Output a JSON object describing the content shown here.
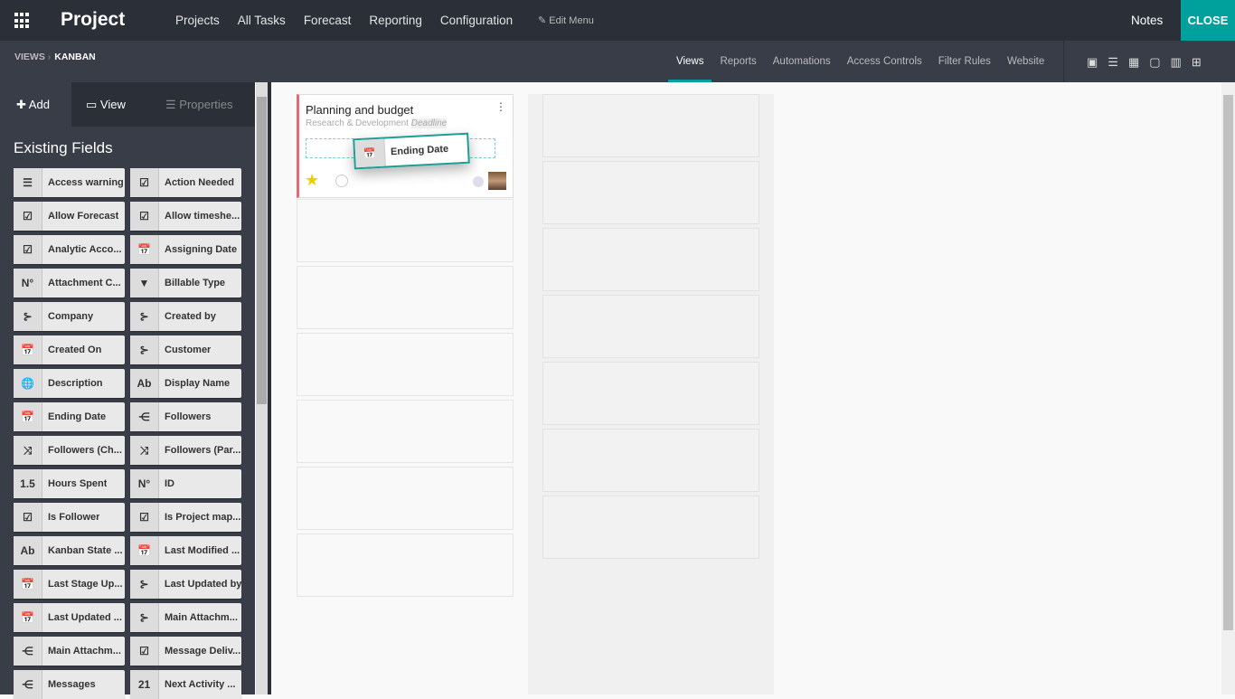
{
  "topbar": {
    "app": "Project",
    "menu": [
      "Projects",
      "All Tasks",
      "Forecast",
      "Reporting",
      "Configuration"
    ],
    "edit_menu": "Edit Menu",
    "notes": "Notes",
    "close": "CLOSE"
  },
  "breadcrumb": {
    "parent": "VIEWS",
    "current": "KANBAN"
  },
  "studio_tabs": [
    "Views",
    "Reports",
    "Automations",
    "Access Controls",
    "Filter Rules",
    "Website"
  ],
  "active_tab": "Views",
  "view_icons": [
    "form-view-icon",
    "list-view-icon",
    "kanban-view-icon",
    "calendar-view-icon",
    "graph-view-icon",
    "pivot-view-icon"
  ],
  "sidebar": {
    "tabs": {
      "add": "Add",
      "view": "View",
      "properties": "Properties"
    },
    "heading": "Existing Fields",
    "fields": [
      [
        "Access warning",
        "text"
      ],
      [
        "Action Needed",
        "bool"
      ],
      [
        "Allow Forecast",
        "bool"
      ],
      [
        "Allow timeshe...",
        "bool"
      ],
      [
        "Analytic Acco...",
        "bool"
      ],
      [
        "Assigning Date",
        "date"
      ],
      [
        "Attachment C...",
        "num"
      ],
      [
        "Billable Type",
        "select"
      ],
      [
        "Company",
        "m2o"
      ],
      [
        "Created by",
        "m2o"
      ],
      [
        "Created On",
        "date"
      ],
      [
        "Customer",
        "m2o"
      ],
      [
        "Description",
        "html"
      ],
      [
        "Display Name",
        "char"
      ],
      [
        "Ending Date",
        "date"
      ],
      [
        "Followers",
        "o2m"
      ],
      [
        "Followers (Ch...",
        "m2m"
      ],
      [
        "Followers (Par...",
        "m2m"
      ],
      [
        "Hours Spent",
        "float"
      ],
      [
        "ID",
        "num"
      ],
      [
        "Is Follower",
        "bool"
      ],
      [
        "Is Project map...",
        "bool"
      ],
      [
        "Kanban State ...",
        "char"
      ],
      [
        "Last Modified ...",
        "date"
      ],
      [
        "Last Stage Up...",
        "date"
      ],
      [
        "Last Updated by",
        "m2o"
      ],
      [
        "Last Updated ...",
        "date"
      ],
      [
        "Main Attachm...",
        "m2o"
      ],
      [
        "Main Attachm...",
        "o2m"
      ],
      [
        "Message Deliv...",
        "bool"
      ],
      [
        "Messages",
        "o2m"
      ],
      [
        "Next Activity ...",
        "date21"
      ]
    ]
  },
  "card": {
    "title": "Planning and budget",
    "subtitle": "Research & Development",
    "deadline": "Deadline"
  },
  "dragging": {
    "label": "Ending Date"
  },
  "accent": "#00a09d"
}
